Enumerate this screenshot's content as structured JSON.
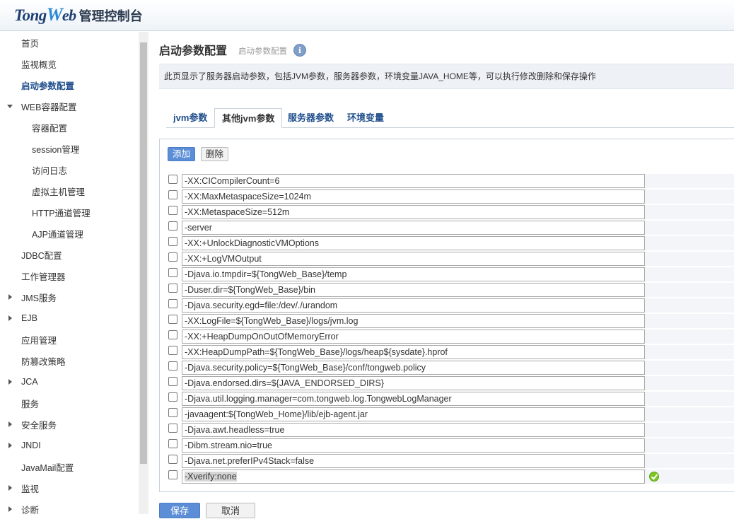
{
  "header": {
    "logo_a": "Tong",
    "logo_b": "W",
    "logo_c": "eb",
    "logo_cn": "管理控制台"
  },
  "sidebar": {
    "items": [
      {
        "label": "首页",
        "indent": 0
      },
      {
        "label": "监视概览",
        "indent": 0
      },
      {
        "label": "启动参数配置",
        "indent": 0,
        "active": true
      },
      {
        "label": "WEB容器配置",
        "indent": 0,
        "caret": "down"
      },
      {
        "label": "容器配置",
        "indent": 1
      },
      {
        "label": "session管理",
        "indent": 1
      },
      {
        "label": "访问日志",
        "indent": 1
      },
      {
        "label": "虚拟主机管理",
        "indent": 1
      },
      {
        "label": "HTTP通道管理",
        "indent": 1
      },
      {
        "label": "AJP通道管理",
        "indent": 1
      },
      {
        "label": "JDBC配置",
        "indent": 0
      },
      {
        "label": "工作管理器",
        "indent": 0
      },
      {
        "label": "JMS服务",
        "indent": 0,
        "caret": "right"
      },
      {
        "label": "EJB",
        "indent": 0,
        "caret": "right"
      },
      {
        "label": "应用管理",
        "indent": 0
      },
      {
        "label": "防篡改策略",
        "indent": 0
      },
      {
        "label": "JCA",
        "indent": 0,
        "caret": "right"
      },
      {
        "label": "服务",
        "indent": 0
      },
      {
        "label": "安全服务",
        "indent": 0,
        "caret": "right"
      },
      {
        "label": "JNDI",
        "indent": 0,
        "caret": "right"
      },
      {
        "label": "JavaMail配置",
        "indent": 0
      },
      {
        "label": "监视",
        "indent": 0,
        "caret": "right"
      },
      {
        "label": "诊断",
        "indent": 0,
        "caret": "right"
      }
    ]
  },
  "main": {
    "title": "启动参数配置",
    "subtitle": "启动参数配置",
    "info_glyph": "i",
    "description": "此页显示了服务器启动参数，包括JVM参数，服务器参数，环境变量JAVA_HOME等，可以执行修改删除和保存操作",
    "tabs": [
      {
        "label": "jvm参数"
      },
      {
        "label": "其他jvm参数",
        "active": true
      },
      {
        "label": "服务器参数"
      },
      {
        "label": "环境变量"
      }
    ],
    "add_label": "添加",
    "delete_label": "删除",
    "params": [
      "-XX:CICompilerCount=6",
      "-XX:MaxMetaspaceSize=1024m",
      "-XX:MetaspaceSize=512m",
      "-server",
      "-XX:+UnlockDiagnosticVMOptions",
      "-XX:+LogVMOutput",
      "-Djava.io.tmpdir=${TongWeb_Base}/temp",
      "-Duser.dir=${TongWeb_Base}/bin",
      "-Djava.security.egd=file:/dev/./urandom",
      "-XX:LogFile=${TongWeb_Base}/logs/jvm.log",
      "-XX:+HeapDumpOnOutOfMemoryError",
      "-XX:HeapDumpPath=${TongWeb_Base}/logs/heap${sysdate}.hprof",
      "-Djava.security.policy=${TongWeb_Base}/conf/tongweb.policy",
      "-Djava.endorsed.dirs=${JAVA_ENDORSED_DIRS}",
      "-Djava.util.logging.manager=com.tongweb.log.TongwebLogManager",
      "-javaagent:${TongWeb_Home}/lib/ejb-agent.jar",
      "-Djava.awt.headless=true",
      "-Dibm.stream.nio=true",
      "-Djava.net.preferIPv4Stack=false",
      "-Xverify:none"
    ],
    "save_label": "保存",
    "cancel_label": "取消"
  }
}
